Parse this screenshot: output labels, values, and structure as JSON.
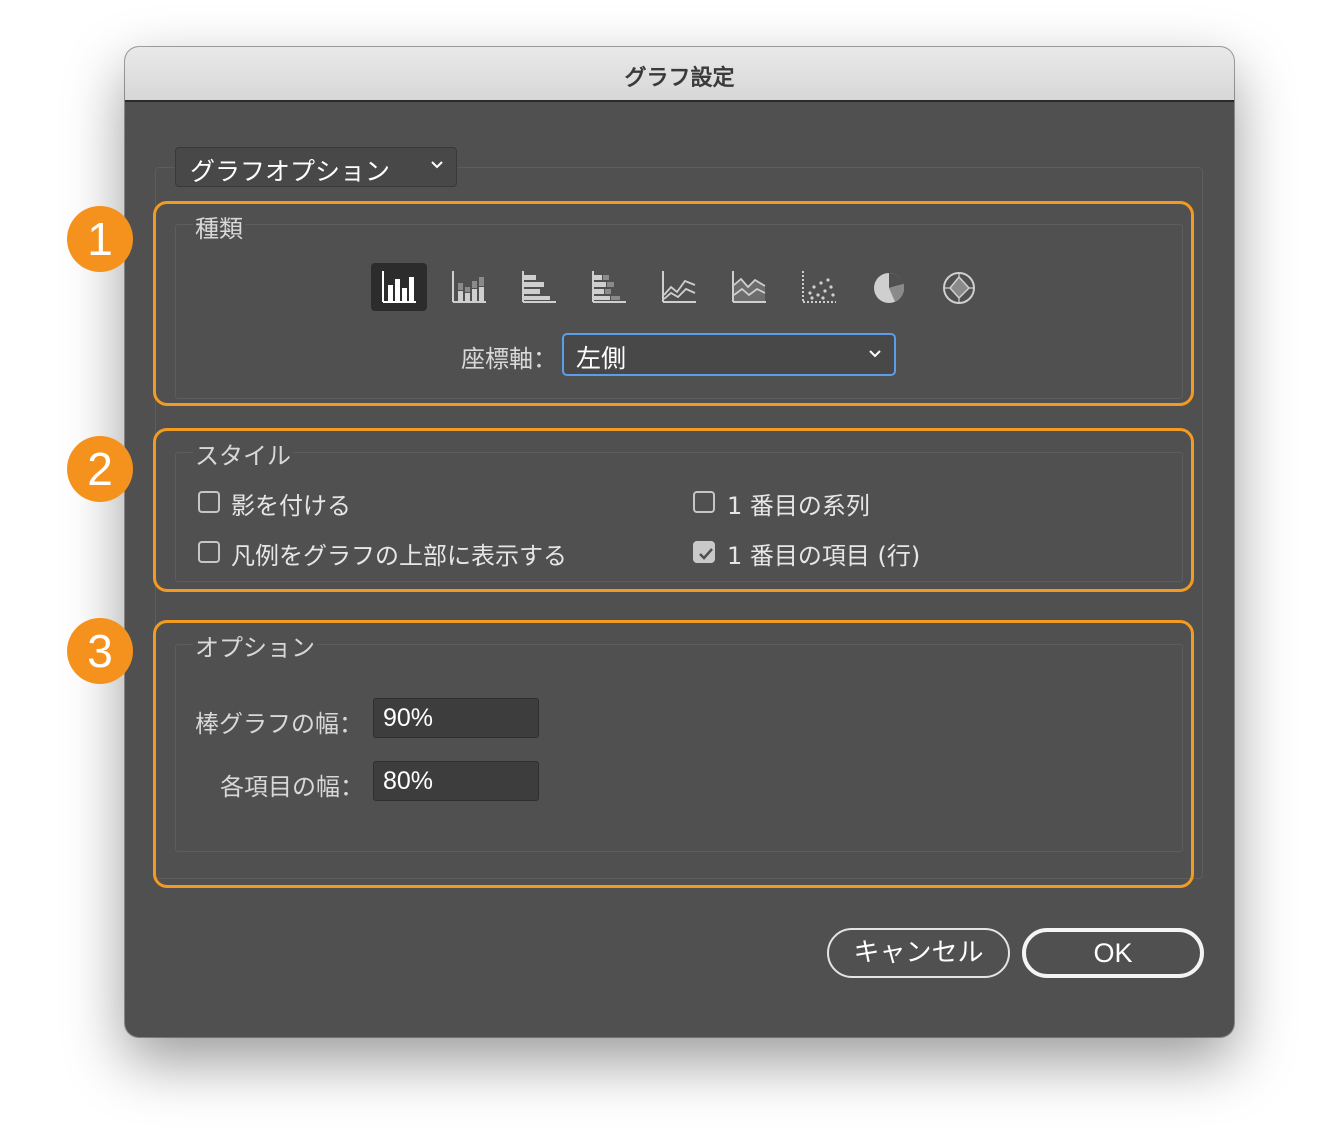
{
  "dialog": {
    "title": "グラフ設定",
    "section_dropdown": "グラフオプション"
  },
  "annotations": {
    "badge1": "1",
    "badge2": "2",
    "badge3": "3",
    "highlight_color": "#f39a21",
    "badge_color": "#f5921e"
  },
  "type_group": {
    "label": "種類",
    "chart_types": [
      {
        "icon": "column-chart-icon",
        "selected": true
      },
      {
        "icon": "stacked-column-chart-icon",
        "selected": false
      },
      {
        "icon": "bar-chart-icon",
        "selected": false
      },
      {
        "icon": "stacked-bar-chart-icon",
        "selected": false
      },
      {
        "icon": "line-chart-icon",
        "selected": false
      },
      {
        "icon": "area-chart-icon",
        "selected": false
      },
      {
        "icon": "scatter-chart-icon",
        "selected": false
      },
      {
        "icon": "pie-chart-icon",
        "selected": false
      },
      {
        "icon": "radar-chart-icon",
        "selected": false
      }
    ],
    "axis_label": "座標軸：",
    "axis_value": "左側"
  },
  "style_group": {
    "label": "スタイル",
    "options": [
      {
        "label": "影を付ける",
        "checked": false
      },
      {
        "label": "1 番目の系列",
        "checked": false
      },
      {
        "label": "凡例をグラフの上部に表示する",
        "checked": false
      },
      {
        "label": "1 番目の項目 (行)",
        "checked": true
      }
    ]
  },
  "options_group": {
    "label": "オプション",
    "bar_width_label": "棒グラフの幅：",
    "bar_width_value": "90%",
    "item_width_label": "各項目の幅：",
    "item_width_value": "80%"
  },
  "buttons": {
    "cancel": "キャンセル",
    "ok": "OK"
  }
}
